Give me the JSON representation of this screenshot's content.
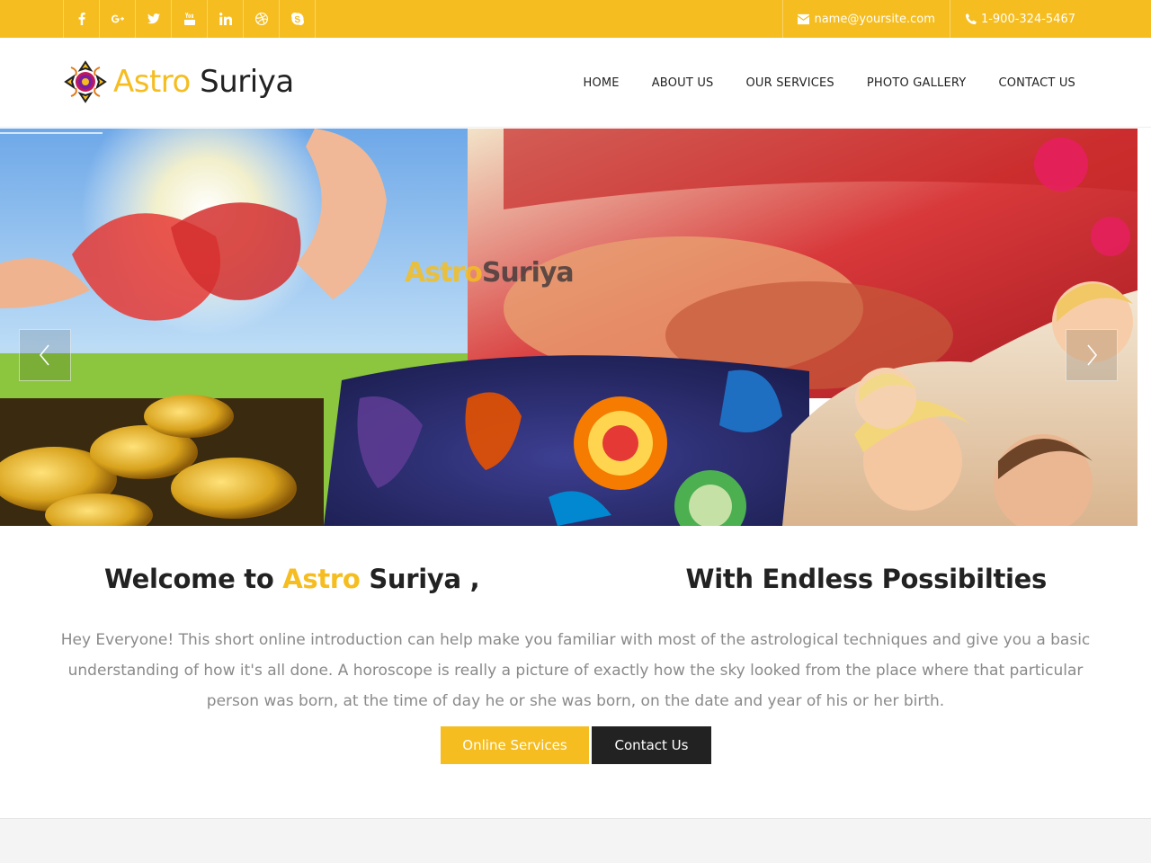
{
  "topbar": {
    "social": [
      {
        "icon": "facebook-icon",
        "glyph": "f"
      },
      {
        "icon": "google-plus-icon",
        "glyph": "g+"
      },
      {
        "icon": "twitter-icon",
        "glyph": "t"
      },
      {
        "icon": "youtube-icon",
        "glyph": "yt"
      },
      {
        "icon": "linkedin-icon",
        "glyph": "in"
      },
      {
        "icon": "dribbble-icon",
        "glyph": "d"
      },
      {
        "icon": "skype-icon",
        "glyph": "s"
      }
    ],
    "email": "name@yoursite.com",
    "phone": "1-900-324-5467"
  },
  "header": {
    "logo_word1": "Astro",
    "logo_word2": "Suriya",
    "nav": [
      "HOME",
      "ABOUT US",
      "OUR SERVICES",
      "PHOTO GALLERY",
      "CONTACT US"
    ]
  },
  "slider": {
    "watermark_word1": "Astro",
    "watermark_word2": "Suriya"
  },
  "welcome": {
    "prefix": "Welcome to ",
    "brand1": "Astro",
    "brand2": " Suriya ,",
    "tagline": "With Endless Possibilties",
    "intro": "Hey Everyone! This short online introduction can help make you familiar with most of the astrological techniques and give you a basic understanding of how it's all done. A horoscope is really a picture of exactly how the sky looked from the place where that particular person was born, at the time of day he or she was born, on the date and year of his or her birth.",
    "btn_services": "Online Services",
    "btn_contact": "Contact Us"
  },
  "colors": {
    "accent": "#f5bd20",
    "dark": "#222222",
    "muted_text": "#8a8a8a"
  }
}
